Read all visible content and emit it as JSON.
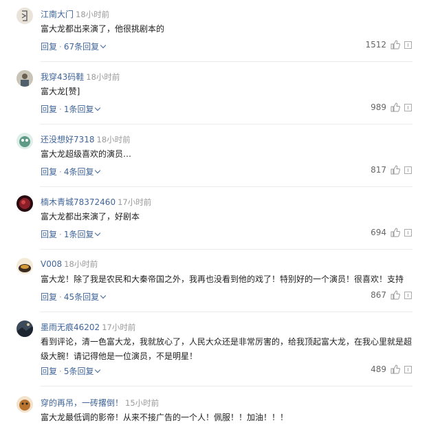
{
  "ui": {
    "reply_label": "回复",
    "separator": "·"
  },
  "comments": [
    {
      "user": "江南大门",
      "time": "18小时前",
      "text": "富大龙都出来演了，他很挑剧本的",
      "replies": "67条回复",
      "likes": "1512",
      "avatar_color": "#e9e3da"
    },
    {
      "user": "我穿43码鞋",
      "time": "18小时前",
      "text": "富大龙[赞]",
      "replies": "1条回复",
      "likes": "989",
      "avatar_color": "#c9c4b8"
    },
    {
      "user": "还没想好7318",
      "time": "18小时前",
      "text": "富大龙超级喜欢的演员…",
      "replies": "4条回复",
      "likes": "817",
      "avatar_color": "#5f9a86"
    },
    {
      "user": "楠木青城78372460",
      "time": "17小时前",
      "text": "富大龙都出来演了，好剧本",
      "replies": "1条回复",
      "likes": "694",
      "avatar_color": "#8a1f2a"
    },
    {
      "user": "V008",
      "time": "18小时前",
      "text": "富大龙！除了我是农民和大秦帝国之外，我再也没看到他的戏了！特别好的一个演员！很喜欢！支持",
      "replies": "45条回复",
      "likes": "867",
      "avatar_color": "#3a2a20"
    },
    {
      "user": "墨雨无痕46202",
      "time": "17小时前",
      "text": "看到评论，清一色富大龙，我就放心了，人民大众还是非常厉害的，给我顶起富大龙，在我心里就是超级大腕！请记得他是一位演员，不是明星！",
      "replies": "5条回复",
      "likes": "489",
      "avatar_color": "#3c4a5a"
    },
    {
      "user": "穿的再吊，一砖撂倒！",
      "time": "15小时前",
      "text": "富大龙最低调的影帝！从来不接广告的一个人！佩服！！加油！！！",
      "replies": "",
      "likes": "",
      "avatar_color": "#b8742e"
    }
  ]
}
